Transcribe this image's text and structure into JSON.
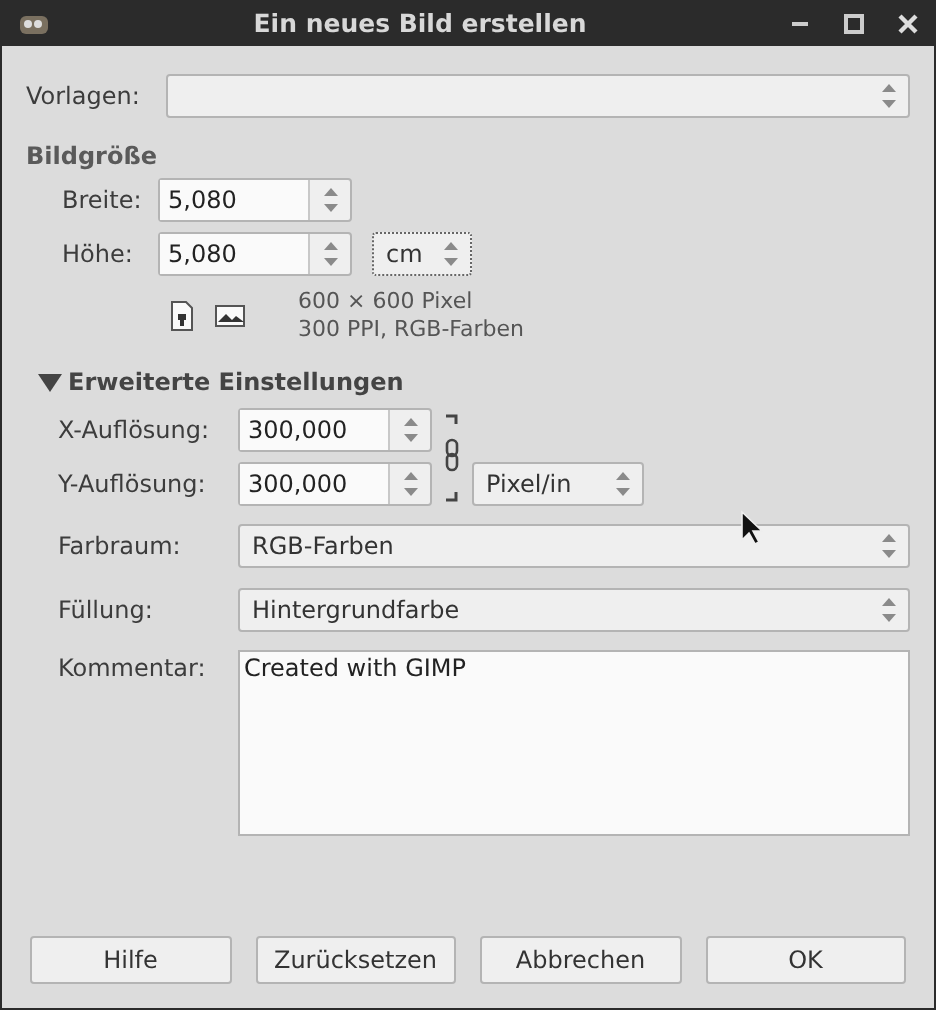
{
  "window": {
    "title": "Ein neues Bild erstellen"
  },
  "template": {
    "label": "Vorlagen:"
  },
  "image_size": {
    "heading": "Bildgröße",
    "width": {
      "label": "Breite:",
      "value": "5,080"
    },
    "height": {
      "label": "Höhe:",
      "value": "5,080"
    },
    "unit": "cm",
    "info": [
      "600 × 600 Pixel",
      "300 PPI, RGB-Farben"
    ]
  },
  "advanced": {
    "heading": "Erweiterte Einstellungen",
    "expanded": true,
    "x_resolution": {
      "label": "X-Auflösung:",
      "value": "300,000"
    },
    "y_resolution": {
      "label": "Y-Auflösung:",
      "value": "300,000"
    },
    "resolution_unit": "Pixel/in",
    "color_space": {
      "label": "Farbraum:",
      "value": "RGB-Farben"
    },
    "fill": {
      "label": "Füllung:",
      "value": "Hintergrundfarbe"
    },
    "comment": {
      "label": "Kommentar:",
      "value": "Created with GIMP"
    }
  },
  "buttons": [
    "Hilfe",
    "Zurücksetzen",
    "Abbrechen",
    "OK"
  ]
}
